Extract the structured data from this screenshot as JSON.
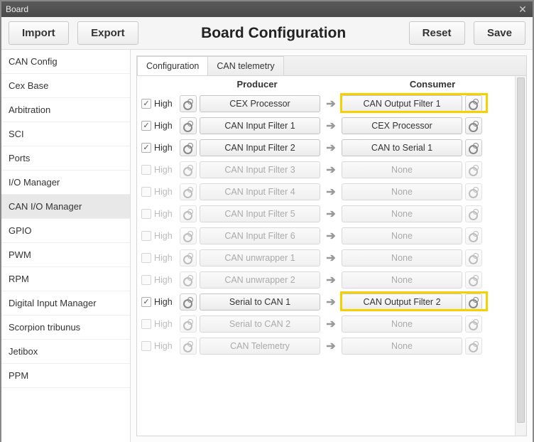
{
  "window": {
    "title": "Board"
  },
  "toolbar": {
    "import": "Import",
    "export": "Export",
    "title": "Board Configuration",
    "reset": "Reset",
    "save": "Save"
  },
  "sidebar": {
    "items": [
      {
        "label": "CAN Config",
        "selected": false
      },
      {
        "label": "Cex Base",
        "selected": false
      },
      {
        "label": "Arbitration",
        "selected": false
      },
      {
        "label": "SCI",
        "selected": false
      },
      {
        "label": "Ports",
        "selected": false
      },
      {
        "label": "I/O Manager",
        "selected": false
      },
      {
        "label": "CAN I/O Manager",
        "selected": true
      },
      {
        "label": "GPIO",
        "selected": false
      },
      {
        "label": "PWM",
        "selected": false
      },
      {
        "label": "RPM",
        "selected": false
      },
      {
        "label": "Digital Input Manager",
        "selected": false
      },
      {
        "label": "Scorpion tribunus",
        "selected": false
      },
      {
        "label": "Jetibox",
        "selected": false
      },
      {
        "label": "PPM",
        "selected": false
      }
    ]
  },
  "tabs": {
    "items": [
      {
        "label": "Configuration",
        "active": true
      },
      {
        "label": "CAN telemetry",
        "active": false
      }
    ]
  },
  "columns": {
    "producer": "Producer",
    "consumer": "Consumer"
  },
  "priority_label": "High",
  "rows": [
    {
      "checked": true,
      "enabled": true,
      "producer": "CEX Processor",
      "consumer": "CAN Output Filter 1",
      "highlight": "consumer"
    },
    {
      "checked": true,
      "enabled": true,
      "producer": "CAN Input Filter 1",
      "consumer": "CEX Processor"
    },
    {
      "checked": true,
      "enabled": true,
      "producer": "CAN Input Filter 2",
      "consumer": "CAN to Serial 1"
    },
    {
      "checked": false,
      "enabled": false,
      "producer": "CAN Input Filter 3",
      "consumer": "None"
    },
    {
      "checked": false,
      "enabled": false,
      "producer": "CAN Input Filter 4",
      "consumer": "None"
    },
    {
      "checked": false,
      "enabled": false,
      "producer": "CAN Input Filter 5",
      "consumer": "None"
    },
    {
      "checked": false,
      "enabled": false,
      "producer": "CAN Input Filter 6",
      "consumer": "None"
    },
    {
      "checked": false,
      "enabled": false,
      "producer": "CAN unwrapper 1",
      "consumer": "None"
    },
    {
      "checked": false,
      "enabled": false,
      "producer": "CAN unwrapper 2",
      "consumer": "None"
    },
    {
      "checked": true,
      "enabled": true,
      "producer": "Serial to CAN 1",
      "consumer": "CAN Output Filter 2",
      "highlight": "consumer"
    },
    {
      "checked": false,
      "enabled": false,
      "producer": "Serial to CAN 2",
      "consumer": "None"
    },
    {
      "checked": false,
      "enabled": false,
      "producer": "CAN Telemetry",
      "consumer": "None"
    }
  ]
}
